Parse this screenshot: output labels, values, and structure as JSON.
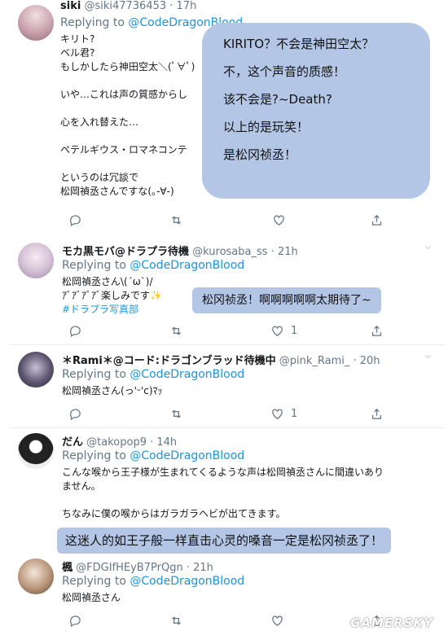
{
  "tweets": [
    {
      "name": "siki",
      "handle": "@siki47736453",
      "time": "· 17h",
      "replying_prefix": "Replying to ",
      "replying_to": "@CodeDragonBlood",
      "lines": [
        "キリト?",
        "ベル君?",
        "もしかしたら神田空太＼(ﾟ∀ﾟ)",
        "",
        "いや…これは声の質感からし",
        "",
        "心を入れ替えた…",
        "",
        "ペテルギウス・ロマネコンテ",
        "",
        "というのは冗談で",
        "松岡禎丞さんですな(｡-∀-)"
      ],
      "like_count": "",
      "overlay": [
        "KIRITO？不会是神田空太？",
        "不，这个声音的质感！",
        "该不会是?~Death?",
        "以上的是玩笑！",
        "是松冈祯丞！"
      ]
    },
    {
      "name": "モカ黒モバ@ドラプラ待機",
      "handle": "@kurosaba_ss",
      "time": "· 21h",
      "replying_prefix": "Replying to ",
      "replying_to": "@CodeDragonBlood",
      "lines": [
        "松岡禎丞さん\\(´ω`)/",
        "ｱﾞｱﾞｱﾞｱﾞ楽しみです✨"
      ],
      "hashtag": "#ドラプラ写真部",
      "like_count": "1",
      "overlay": "松冈祯丞！啊啊啊啊啊太期待了~"
    },
    {
      "name": "＊Rami＊@コード:ドラゴンブラッド待機中",
      "handle": "@pink_Rami_",
      "time": "· 20h",
      "replying_prefix": "Replying to ",
      "replying_to": "@CodeDragonBlood",
      "lines": [
        "松岡禎丞さん(っ'ᵕ'c)ﾏｯ"
      ],
      "like_count": "1"
    },
    {
      "name": "だん",
      "handle": "@takopop9",
      "time": "· 14h",
      "replying_prefix": "Replying to ",
      "replying_to": "@CodeDragonBlood",
      "lines": [
        "こんな喉から王子様が生まれてくるような声は松岡禎丞さんに間違いあり",
        "ません。",
        "",
        "ちなみに僕の喉からはガラガラヘビが出てきます。"
      ],
      "overlay": "这迷人的如王子般一样直击心灵的嗓音一定是松冈祯丞了！"
    },
    {
      "name": "楓",
      "handle": "@FDGIfHEyB7PrQgn",
      "time": "· 21h",
      "replying_prefix": "Replying to ",
      "replying_to": "@CodeDragonBlood",
      "lines": [
        "松岡禎丞さん"
      ]
    }
  ],
  "watermark": "GAMERSKY",
  "colors": {
    "link": "#1b95e0",
    "muted": "#657786",
    "highlight": "#b4c6e6"
  }
}
